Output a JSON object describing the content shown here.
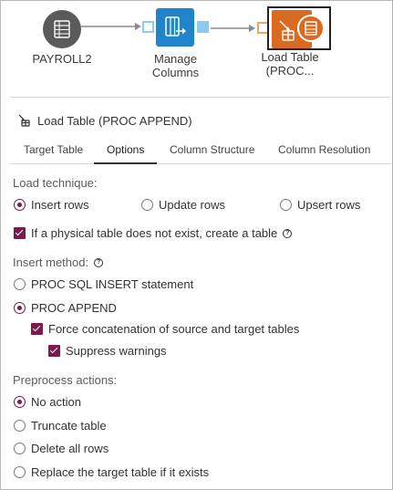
{
  "flow": {
    "nodes": [
      {
        "id": "payroll2",
        "label": "PAYROLL2",
        "icon": "table-icon"
      },
      {
        "id": "manage-columns",
        "label_line1": "Manage",
        "label_line2": "Columns",
        "icon": "manage-columns-icon"
      },
      {
        "id": "load-table",
        "label_line1": "Load Table",
        "label_line2": "(PROC...",
        "icon": "load-table-icon"
      }
    ],
    "colors": {
      "node_grey": "#5a5a5a",
      "node_blue": "#1f84c9",
      "node_orange": "#d86b21",
      "port_blue": "#8ccaf0",
      "port_orange": "#f2a36a"
    }
  },
  "panel": {
    "title": "Load Table (PROC APPEND)",
    "title_icon": "load-table-icon"
  },
  "tabs": [
    {
      "label": "Target Table",
      "active": false
    },
    {
      "label": "Options",
      "active": true
    },
    {
      "label": "Column Structure",
      "active": false
    },
    {
      "label": "Column Resolution",
      "active": false
    }
  ],
  "load_technique": {
    "label": "Load technique:",
    "options": [
      {
        "label": "Insert rows",
        "selected": true
      },
      {
        "label": "Update rows",
        "selected": false
      },
      {
        "label": "Upsert rows",
        "selected": false
      }
    ]
  },
  "create_table": {
    "label": "If a physical table does not exist, create a table",
    "checked": true
  },
  "insert_method": {
    "label": "Insert method:",
    "options": [
      {
        "label": "PROC SQL INSERT statement",
        "selected": false
      },
      {
        "label": "PROC APPEND",
        "selected": true
      }
    ],
    "force_concat": {
      "label": "Force concatenation of source and target tables",
      "checked": true
    },
    "suppress_warnings": {
      "label": "Suppress warnings",
      "checked": true
    }
  },
  "preprocess": {
    "label": "Preprocess actions:",
    "options": [
      {
        "label": "No action",
        "selected": true
      },
      {
        "label": "Truncate table",
        "selected": false
      },
      {
        "label": "Delete all rows",
        "selected": false
      },
      {
        "label": "Replace the target table if it exists",
        "selected": false
      }
    ]
  },
  "accent_color": "#7d1a4d"
}
